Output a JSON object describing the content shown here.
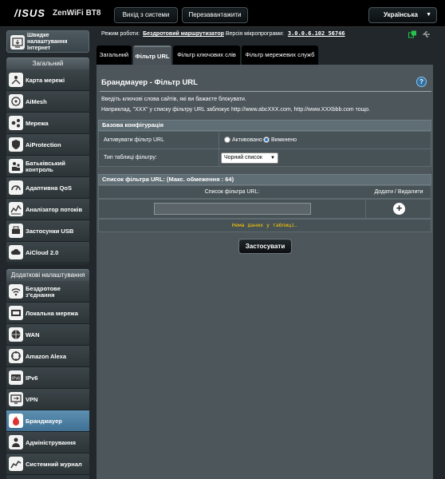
{
  "header": {
    "brand": "/ISUS",
    "model": "ZenWiFi BT8",
    "logout_label": "Вихід з системи",
    "reboot_label": "Перезавантажити",
    "language": "Українська"
  },
  "status": {
    "mode_label": "Режим роботи:",
    "mode_value": "Бездротовий маршрутизатор",
    "firmware_label": "Версія мікропрограми:",
    "firmware_value": "3.0.0.6.102_56746"
  },
  "sidebar": {
    "quick_setup": "Швидке налаштування Інтернет",
    "general_title": "Загальний",
    "general_items": [
      {
        "label": "Карта мережі",
        "icon": "network-map-icon"
      },
      {
        "label": "AiMesh",
        "icon": "aimesh-icon"
      },
      {
        "label": "Мережа",
        "icon": "network-icon"
      },
      {
        "label": "AiProtection",
        "icon": "aiprotection-icon"
      },
      {
        "label": "Батьківський контроль",
        "icon": "parental-control-icon"
      },
      {
        "label": "Адаптивна QoS",
        "icon": "qos-icon"
      },
      {
        "label": "Аналізатор потоків",
        "icon": "traffic-analyzer-icon"
      },
      {
        "label": "Застосунки USB",
        "icon": "usb-icon"
      },
      {
        "label": "AiCloud 2.0",
        "icon": "aicloud-icon"
      }
    ],
    "advanced_title": "Додаткові налаштування",
    "advanced_items": [
      {
        "label": "Бездротове з'єднання",
        "icon": "wireless-icon"
      },
      {
        "label": "Локальна мережа",
        "icon": "lan-icon"
      },
      {
        "label": "WAN",
        "icon": "wan-icon"
      },
      {
        "label": "Amazon Alexa",
        "icon": "alexa-icon"
      },
      {
        "label": "IPv6",
        "icon": "ipv6-icon"
      },
      {
        "label": "VPN",
        "icon": "vpn-icon"
      },
      {
        "label": "Брандмауер",
        "icon": "firewall-icon",
        "active": true
      },
      {
        "label": "Адміністрування",
        "icon": "administration-icon"
      },
      {
        "label": "Системний журнал",
        "icon": "system-log-icon"
      }
    ]
  },
  "tabs": [
    {
      "label": "Загальний",
      "active": false
    },
    {
      "label": "Фільтр URL",
      "active": true
    },
    {
      "label": "Фільтр ключових слів",
      "active": false
    },
    {
      "label": "Фільтр мережевих служб",
      "active": false
    }
  ],
  "page": {
    "title": "Брандмауер - Фільтр URL",
    "help_symbol": "?",
    "desc1": "Введіть ключові слова сайтів, які ви бажаєте блокувати.",
    "desc2": "Наприклад, \"XXX\" у списку фільтру URL заблокує http://www.abcXXX.com, http://www.XXXbbb.com тощо.",
    "basic_section": "Базова конфігурація",
    "enable_label": "Активувати фільтр URL",
    "enable_options": [
      "Активовано",
      "Вимкнено"
    ],
    "enable_selected": "Вимкнено",
    "table_type_label": "Тип таблиці фільтру:",
    "table_type_value": "Чорний список",
    "list_section": "Список фільтра URL: (Макс. обмеження : 64)",
    "col_list": "Список фільтра URL:",
    "col_action": "Додати / Видалити",
    "url_input_value": "",
    "add_symbol": "+",
    "empty_text": "Нема даних у таблиці.",
    "apply_label": "Застосувати"
  },
  "colors": {
    "accent": "#3f7094",
    "empty_text": "#ffcc00",
    "background": "#21272b",
    "panel": "#4d565b"
  }
}
